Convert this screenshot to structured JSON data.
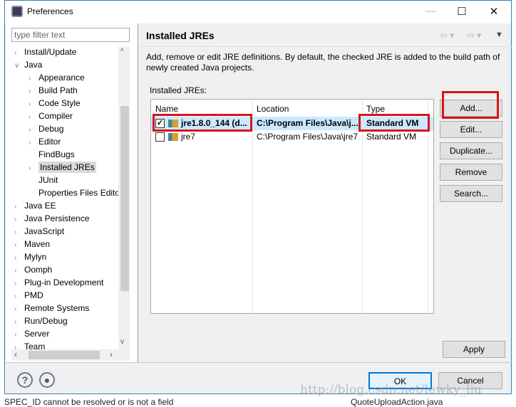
{
  "window": {
    "title": "Preferences"
  },
  "filter": {
    "placeholder": "type filter text"
  },
  "tree": [
    {
      "label": "Install/Update",
      "level": 0,
      "expander": "collapsed"
    },
    {
      "label": "Java",
      "level": 0,
      "expander": "expanded"
    },
    {
      "label": "Appearance",
      "level": 1,
      "expander": "collapsed"
    },
    {
      "label": "Build Path",
      "level": 1,
      "expander": "collapsed"
    },
    {
      "label": "Code Style",
      "level": 1,
      "expander": "collapsed"
    },
    {
      "label": "Compiler",
      "level": 1,
      "expander": "collapsed"
    },
    {
      "label": "Debug",
      "level": 1,
      "expander": "collapsed"
    },
    {
      "label": "Editor",
      "level": 1,
      "expander": "collapsed"
    },
    {
      "label": "FindBugs",
      "level": 1,
      "expander": "none"
    },
    {
      "label": "Installed JREs",
      "level": 1,
      "expander": "collapsed",
      "selected": true
    },
    {
      "label": "JUnit",
      "level": 1,
      "expander": "none"
    },
    {
      "label": "Properties Files Editor",
      "level": 1,
      "expander": "none"
    },
    {
      "label": "Java EE",
      "level": 0,
      "expander": "collapsed"
    },
    {
      "label": "Java Persistence",
      "level": 0,
      "expander": "collapsed"
    },
    {
      "label": "JavaScript",
      "level": 0,
      "expander": "collapsed"
    },
    {
      "label": "Maven",
      "level": 0,
      "expander": "collapsed"
    },
    {
      "label": "Mylyn",
      "level": 0,
      "expander": "collapsed"
    },
    {
      "label": "Oomph",
      "level": 0,
      "expander": "collapsed"
    },
    {
      "label": "Plug-in Development",
      "level": 0,
      "expander": "collapsed"
    },
    {
      "label": "PMD",
      "level": 0,
      "expander": "collapsed"
    },
    {
      "label": "Remote Systems",
      "level": 0,
      "expander": "collapsed"
    },
    {
      "label": "Run/Debug",
      "level": 0,
      "expander": "collapsed"
    },
    {
      "label": "Server",
      "level": 0,
      "expander": "collapsed"
    },
    {
      "label": "Team",
      "level": 0,
      "expander": "collapsed"
    }
  ],
  "page": {
    "title": "Installed JREs",
    "description": "Add, remove or edit JRE definitions. By default, the checked JRE is added to the build path of newly created Java projects.",
    "table_label": "Installed JREs:",
    "columns": [
      "Name",
      "Location",
      "Type"
    ],
    "rows": [
      {
        "checked": true,
        "name": "jre1.8.0_144 (d...",
        "location": "C:\\Program Files\\Java\\j...",
        "type": "Standard VM",
        "selected": true
      },
      {
        "checked": false,
        "name": "jre7",
        "location": "C:\\Program Files\\Java\\jre7",
        "type": "Standard VM"
      }
    ],
    "buttons": {
      "add": "Add...",
      "edit": "Edit...",
      "duplicate": "Duplicate...",
      "remove": "Remove",
      "search": "Search..."
    },
    "apply": "Apply"
  },
  "footer": {
    "ok": "OK",
    "cancel": "Cancel"
  },
  "watermark": "http://blog.csdn.net/lewky_liu",
  "background": {
    "status_left": "SPEC_ID cannot be resolved or is not a field",
    "status_right": "QuoteUploadAction.java"
  },
  "colors": {
    "highlight_red": "#d9141b",
    "selection": "#cce8ff",
    "accent": "#3c7fb1"
  }
}
